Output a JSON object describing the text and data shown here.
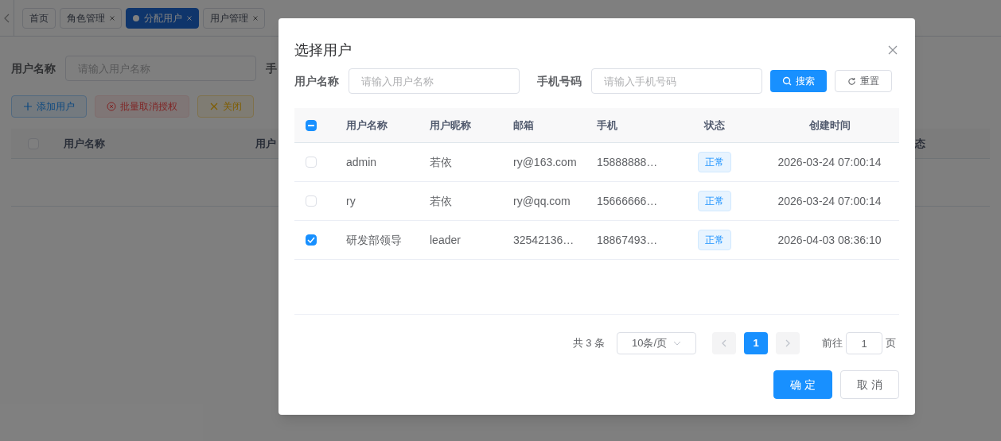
{
  "background": {
    "tabs": [
      {
        "label": "首页",
        "closable": false,
        "selected": false
      },
      {
        "label": "角色管理",
        "closable": true,
        "selected": false
      },
      {
        "label": "分配用户",
        "closable": true,
        "selected": true
      },
      {
        "label": "用户管理",
        "closable": true,
        "selected": false
      }
    ],
    "search": {
      "label": "用户名称",
      "placeholder": "请输入用户名称",
      "next_label": "手"
    },
    "buttons": [
      {
        "label": "添加用户",
        "kind": "primary"
      },
      {
        "label": "批量取消授权",
        "kind": "danger"
      },
      {
        "label": "关闭",
        "kind": "warning"
      }
    ],
    "table": {
      "select_all_checked": false,
      "columns": [
        "用户名称",
        "用户",
        "态"
      ]
    }
  },
  "dialog": {
    "title": "选择用户",
    "search": [
      {
        "label": "用户名称",
        "placeholder": "请输入用户名称"
      },
      {
        "label": "手机号码",
        "placeholder": "请输入手机号码"
      }
    ],
    "search_button": "搜索",
    "reset_button": "重置",
    "table": {
      "select_all": {
        "indeterminate": true
      },
      "columns": [
        "用户名称",
        "用户昵称",
        "邮箱",
        "手机",
        "状态",
        "创建时间"
      ],
      "rows": [
        {
          "checked": false,
          "cells": [
            "admin",
            "若依",
            "ry@163.com",
            "15888888…",
            "正常",
            "2026-03-24 07:00:14"
          ]
        },
        {
          "checked": false,
          "cells": [
            "ry",
            "若依",
            "ry@qq.com",
            "15666666…",
            "正常",
            "2026-03-24 07:00:14"
          ]
        },
        {
          "checked": true,
          "cells": [
            "研发部领导",
            "leader",
            "32542136…",
            "18867493…",
            "正常",
            "2026-04-03 08:36:10"
          ]
        }
      ]
    },
    "pagination": {
      "total": "共 3 条",
      "page_size": "10条/页",
      "pages": [
        {
          "label": "1",
          "selected": true
        }
      ],
      "goto_label": "前往",
      "goto_value": "1",
      "goto_suffix": "页"
    },
    "buttons": [
      {
        "label": "确 定",
        "kind": "primary"
      },
      {
        "label": "取 消",
        "kind": "default"
      }
    ]
  }
}
